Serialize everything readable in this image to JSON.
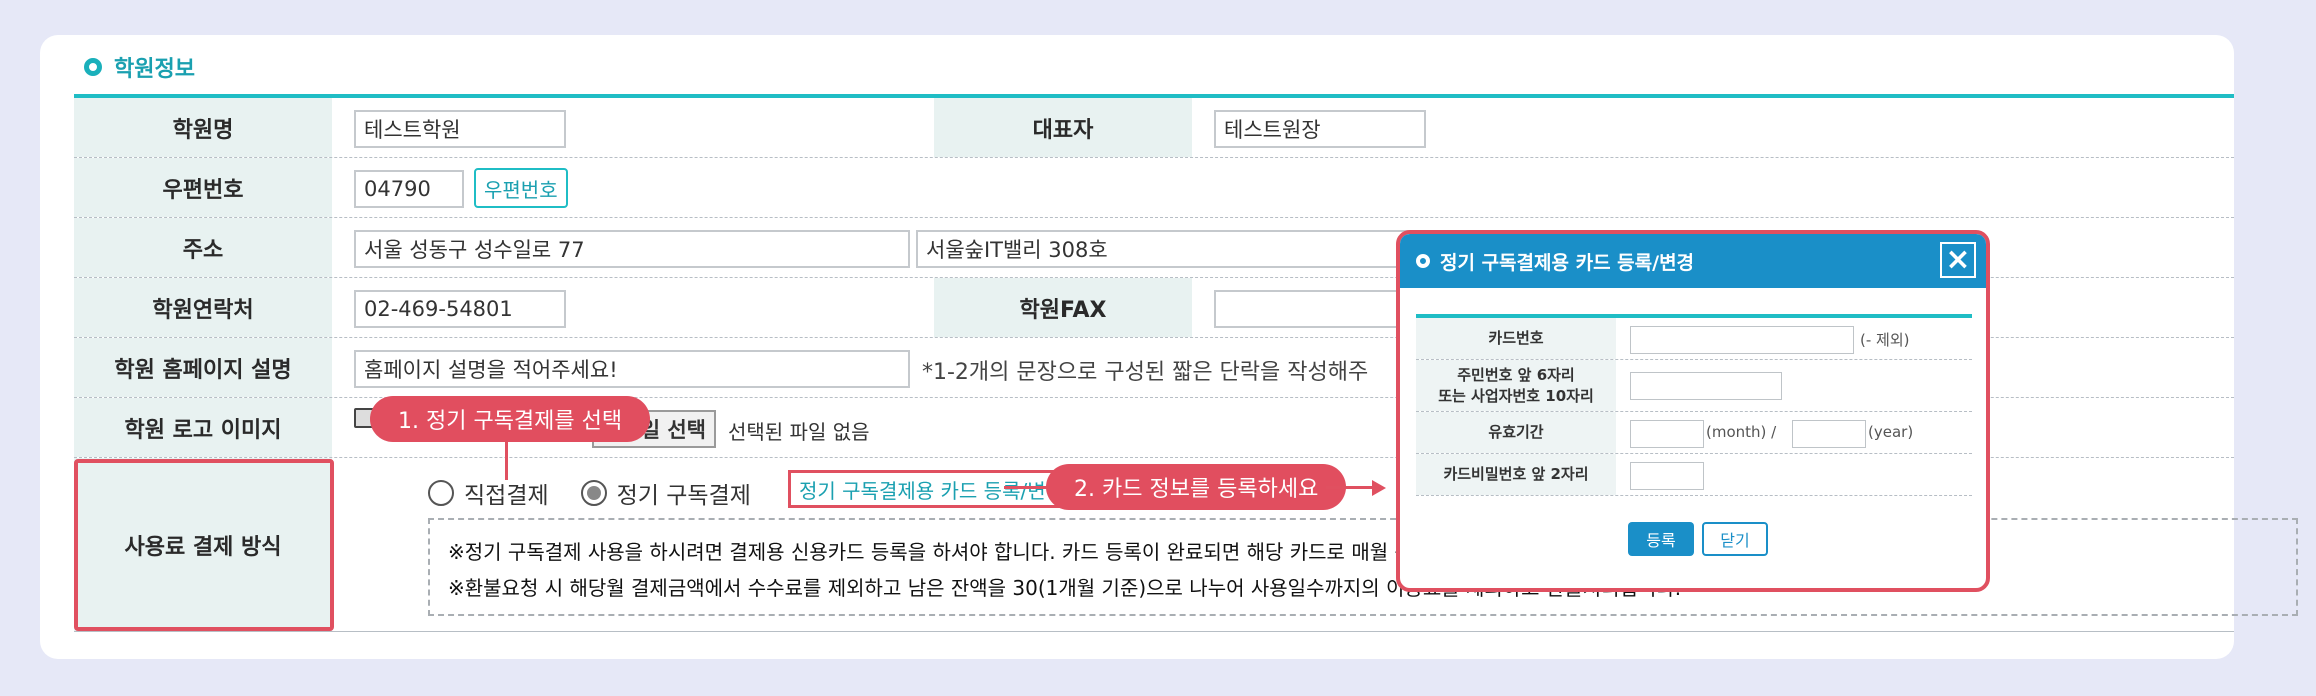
{
  "section": {
    "title": "학원정보"
  },
  "rows": {
    "academy_name": {
      "label": "학원명",
      "value": "테스트학원"
    },
    "representative": {
      "label": "대표자",
      "value": "테스트원장"
    },
    "postal": {
      "label": "우편번호",
      "value": "04790",
      "button": "우편번호"
    },
    "address": {
      "label": "주소",
      "value1": "서울 성동구 성수일로 77",
      "value2": "서울숲IT밸리 308호"
    },
    "phone": {
      "label": "학원연락처",
      "value": "02-469-54801"
    },
    "fax": {
      "label": "학원FAX",
      "value": ""
    },
    "homepage": {
      "label": "학원 홈페이지 설명",
      "value": "홈페이지 설명을 적어주세요!",
      "note": "*1-2개의 문장으로 구성된 짧은 단락을 작성해주"
    },
    "logo": {
      "label": "학원 로고 이미지",
      "file_button": "일 선택",
      "file_status": "선택된 파일 없음"
    },
    "payment": {
      "label": "사용료 결제 방식",
      "options": [
        "직접결제",
        "정기 구독결제"
      ],
      "selected": "정기 구독결제",
      "card_link": "정기 구독결제용 카드 등록/변경",
      "notice1": "※정기 구독결제 사용을 하시려면 결제용 신용카드 등록을 하셔야 합니다. 카드 등록이 완료되면 해당 카드로 매월 동일",
      "notice2": "※환불요청 시 해당월 결제금액에서 수수료를 제외하고 남은 잔액을 30(1개월 기준)으로 나누어 사용일수까지의 이용료를 제외하고 환불처리됩니다."
    }
  },
  "callouts": {
    "step1": "1. 정기 구독결제를 선택",
    "step2": "2. 카드 정보를 등록하세요"
  },
  "modal": {
    "title": "정기 구독결제용 카드 등록/변경",
    "fields": {
      "card_number": {
        "label": "카드번호",
        "hint": "(- 제외)"
      },
      "id_number": {
        "label1": "주민번호 앞 6자리",
        "label2": "또는 사업자번호 10자리"
      },
      "expiry": {
        "label": "유효기간",
        "month": "(month) /",
        "year": "(year)"
      },
      "password": {
        "label": "카드비밀번호 앞 2자리"
      }
    },
    "buttons": {
      "submit": "등록",
      "close": "닫기"
    }
  },
  "colors": {
    "accent": "#1fbdc5",
    "callout": "#e14e5f",
    "modal_header": "#1a8fc8"
  }
}
